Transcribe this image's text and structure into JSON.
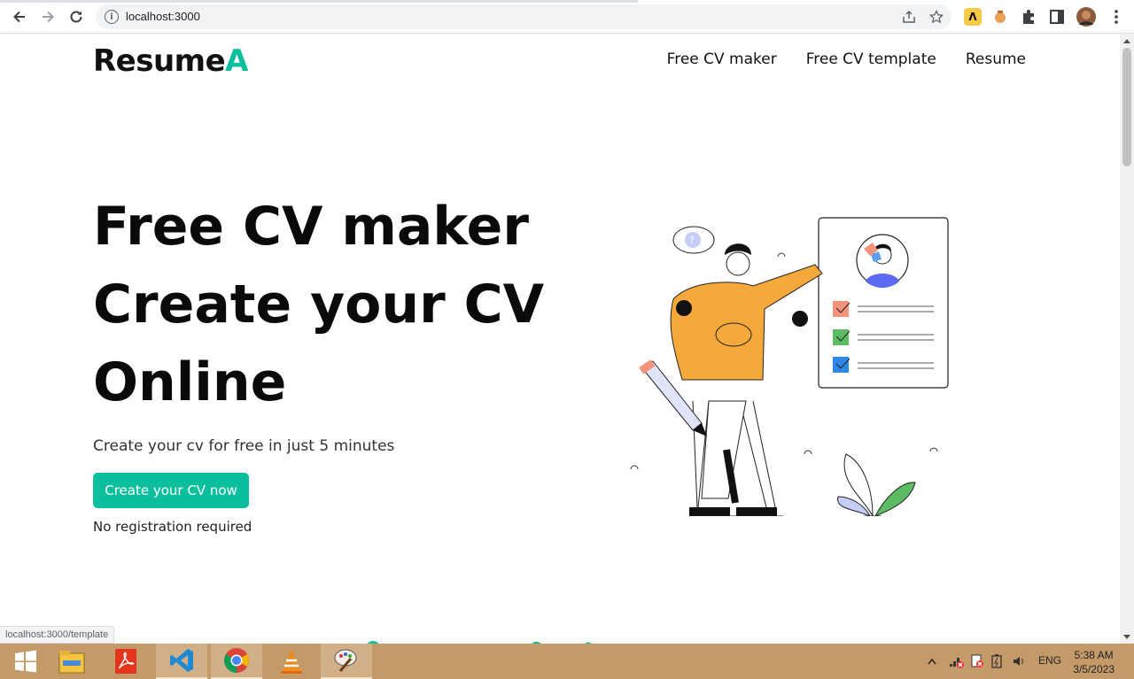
{
  "browser": {
    "url": "localhost:3000",
    "info_icon": "i"
  },
  "status_bar": {
    "link_preview": "localhost:3000/template"
  },
  "site": {
    "logo_main": "Resume",
    "logo_accent": "A",
    "accent_color": "#0bbf9c",
    "nav": [
      "Free CV maker",
      "Free CV template",
      "Resume"
    ]
  },
  "hero": {
    "title_lines": [
      "Free CV maker",
      "Create your CV",
      "Online"
    ],
    "subtitle": "Create your cv for free in just 5 minutes",
    "cta_label": "Create your CV now",
    "note": "No registration required",
    "illustration_icon": "person-resume-illustration"
  },
  "taskbar": {
    "apps": [
      "start-icon",
      "file-explorer-icon",
      "acrobat-icon",
      "vscode-icon",
      "chrome-icon",
      "vlc-icon",
      "paint-icon"
    ],
    "language": "ENG",
    "time": "5:38 AM",
    "date": "3/5/2023"
  }
}
